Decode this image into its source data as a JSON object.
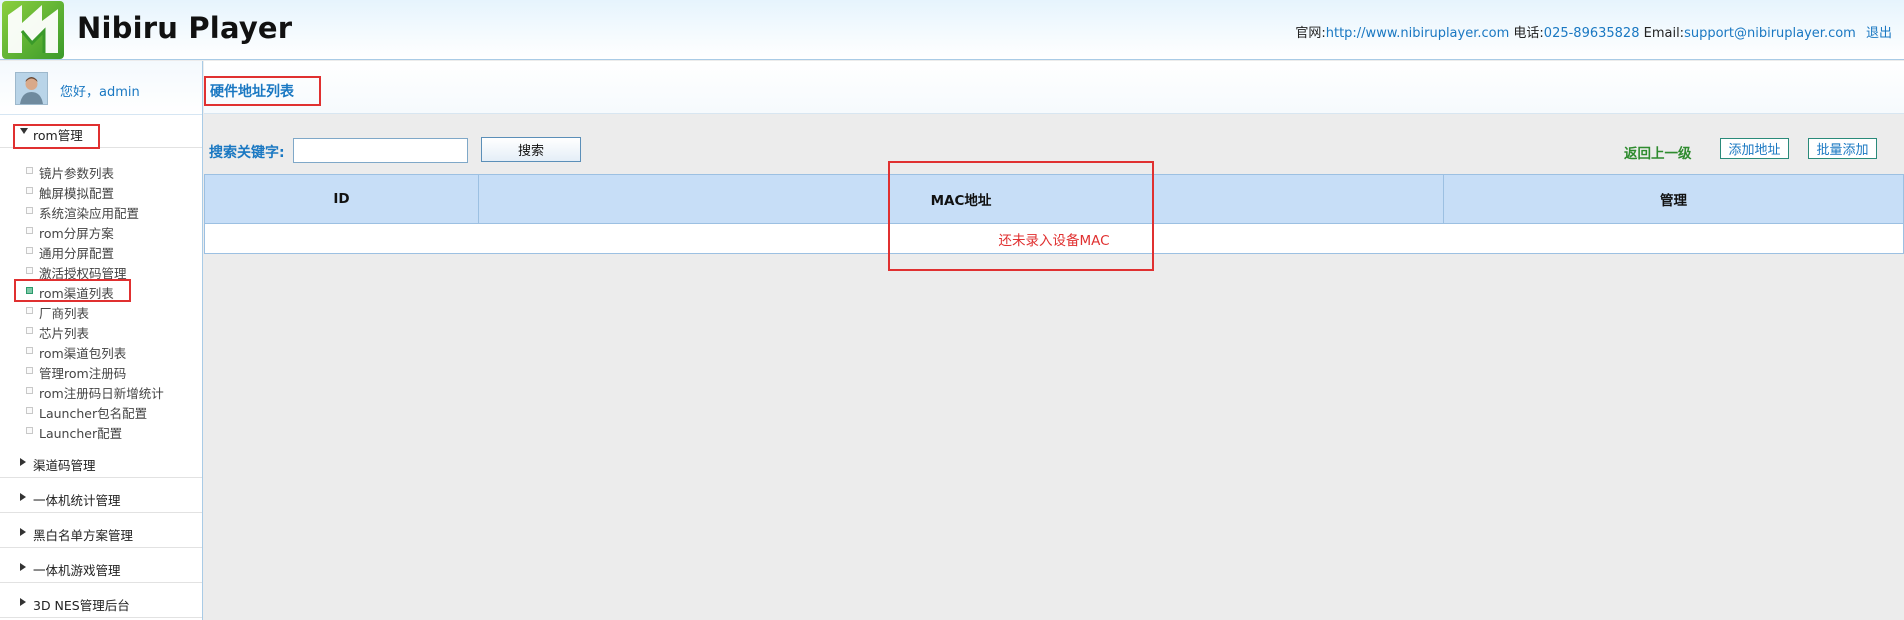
{
  "header": {
    "brand": "Nibiru Player",
    "site_label": "官网:",
    "site_url": "http://www.nibiruplayer.com",
    "phone_label": "电话:",
    "phone": "025-89635828",
    "email_label": "Email:",
    "email": "support@nibiruplayer.com",
    "logout": "退出"
  },
  "sidebar": {
    "greeting": "您好，admin",
    "groups": [
      {
        "label": "rom管理",
        "expanded": true,
        "items": [
          {
            "label": "镜片参数列表"
          },
          {
            "label": "触屏模拟配置"
          },
          {
            "label": "系统渲染应用配置"
          },
          {
            "label": "rom分屏方案"
          },
          {
            "label": "通用分屏配置"
          },
          {
            "label": "激活授权码管理"
          },
          {
            "label": "rom渠道列表",
            "active": true
          },
          {
            "label": "厂商列表"
          },
          {
            "label": "芯片列表"
          },
          {
            "label": "rom渠道包列表"
          },
          {
            "label": "管理rom注册码"
          },
          {
            "label": "rom注册码日新增统计"
          },
          {
            "label": "Launcher包名配置"
          },
          {
            "label": "Launcher配置"
          }
        ]
      },
      {
        "label": "渠道码管理"
      },
      {
        "label": "一体机统计管理"
      },
      {
        "label": "黑白名单方案管理"
      },
      {
        "label": "一体机游戏管理"
      },
      {
        "label": "3D NES管理后台"
      }
    ]
  },
  "main": {
    "title": "硬件地址列表",
    "search_label": "搜索关键字:",
    "search_value": "",
    "search_button": "搜索",
    "back_link": "返回上一级",
    "add_button": "添加地址",
    "batch_add_button": "批量添加",
    "table": {
      "columns": [
        "ID",
        "MAC地址",
        "管理"
      ],
      "empty_message": "还未录入设备MAC"
    }
  },
  "colors": {
    "accent": "#1a78c2",
    "header_row": "#c7def7",
    "highlight_red": "#e03030",
    "back_link_green": "#2e8b2e"
  }
}
